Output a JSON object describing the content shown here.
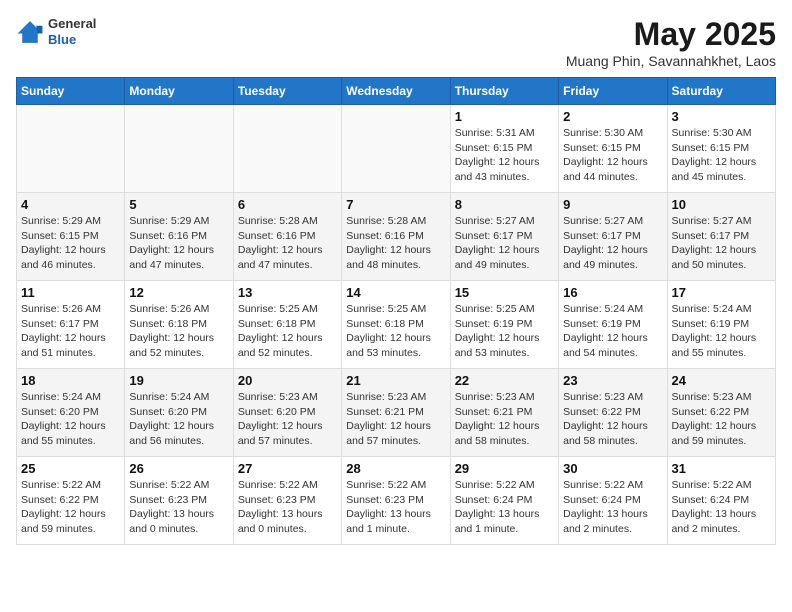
{
  "app": {
    "name_general": "General",
    "name_blue": "Blue"
  },
  "title": "May 2025",
  "subtitle": "Muang Phin, Savannahkhet, Laos",
  "days_of_week": [
    "Sunday",
    "Monday",
    "Tuesday",
    "Wednesday",
    "Thursday",
    "Friday",
    "Saturday"
  ],
  "weeks": [
    [
      {
        "day": "",
        "info": ""
      },
      {
        "day": "",
        "info": ""
      },
      {
        "day": "",
        "info": ""
      },
      {
        "day": "",
        "info": ""
      },
      {
        "day": "1",
        "info": "Sunrise: 5:31 AM\nSunset: 6:15 PM\nDaylight: 12 hours and 43 minutes."
      },
      {
        "day": "2",
        "info": "Sunrise: 5:30 AM\nSunset: 6:15 PM\nDaylight: 12 hours and 44 minutes."
      },
      {
        "day": "3",
        "info": "Sunrise: 5:30 AM\nSunset: 6:15 PM\nDaylight: 12 hours and 45 minutes."
      }
    ],
    [
      {
        "day": "4",
        "info": "Sunrise: 5:29 AM\nSunset: 6:15 PM\nDaylight: 12 hours and 46 minutes."
      },
      {
        "day": "5",
        "info": "Sunrise: 5:29 AM\nSunset: 6:16 PM\nDaylight: 12 hours and 47 minutes."
      },
      {
        "day": "6",
        "info": "Sunrise: 5:28 AM\nSunset: 6:16 PM\nDaylight: 12 hours and 47 minutes."
      },
      {
        "day": "7",
        "info": "Sunrise: 5:28 AM\nSunset: 6:16 PM\nDaylight: 12 hours and 48 minutes."
      },
      {
        "day": "8",
        "info": "Sunrise: 5:27 AM\nSunset: 6:17 PM\nDaylight: 12 hours and 49 minutes."
      },
      {
        "day": "9",
        "info": "Sunrise: 5:27 AM\nSunset: 6:17 PM\nDaylight: 12 hours and 49 minutes."
      },
      {
        "day": "10",
        "info": "Sunrise: 5:27 AM\nSunset: 6:17 PM\nDaylight: 12 hours and 50 minutes."
      }
    ],
    [
      {
        "day": "11",
        "info": "Sunrise: 5:26 AM\nSunset: 6:17 PM\nDaylight: 12 hours and 51 minutes."
      },
      {
        "day": "12",
        "info": "Sunrise: 5:26 AM\nSunset: 6:18 PM\nDaylight: 12 hours and 52 minutes."
      },
      {
        "day": "13",
        "info": "Sunrise: 5:25 AM\nSunset: 6:18 PM\nDaylight: 12 hours and 52 minutes."
      },
      {
        "day": "14",
        "info": "Sunrise: 5:25 AM\nSunset: 6:18 PM\nDaylight: 12 hours and 53 minutes."
      },
      {
        "day": "15",
        "info": "Sunrise: 5:25 AM\nSunset: 6:19 PM\nDaylight: 12 hours and 53 minutes."
      },
      {
        "day": "16",
        "info": "Sunrise: 5:24 AM\nSunset: 6:19 PM\nDaylight: 12 hours and 54 minutes."
      },
      {
        "day": "17",
        "info": "Sunrise: 5:24 AM\nSunset: 6:19 PM\nDaylight: 12 hours and 55 minutes."
      }
    ],
    [
      {
        "day": "18",
        "info": "Sunrise: 5:24 AM\nSunset: 6:20 PM\nDaylight: 12 hours and 55 minutes."
      },
      {
        "day": "19",
        "info": "Sunrise: 5:24 AM\nSunset: 6:20 PM\nDaylight: 12 hours and 56 minutes."
      },
      {
        "day": "20",
        "info": "Sunrise: 5:23 AM\nSunset: 6:20 PM\nDaylight: 12 hours and 57 minutes."
      },
      {
        "day": "21",
        "info": "Sunrise: 5:23 AM\nSunset: 6:21 PM\nDaylight: 12 hours and 57 minutes."
      },
      {
        "day": "22",
        "info": "Sunrise: 5:23 AM\nSunset: 6:21 PM\nDaylight: 12 hours and 58 minutes."
      },
      {
        "day": "23",
        "info": "Sunrise: 5:23 AM\nSunset: 6:22 PM\nDaylight: 12 hours and 58 minutes."
      },
      {
        "day": "24",
        "info": "Sunrise: 5:23 AM\nSunset: 6:22 PM\nDaylight: 12 hours and 59 minutes."
      }
    ],
    [
      {
        "day": "25",
        "info": "Sunrise: 5:22 AM\nSunset: 6:22 PM\nDaylight: 12 hours and 59 minutes."
      },
      {
        "day": "26",
        "info": "Sunrise: 5:22 AM\nSunset: 6:23 PM\nDaylight: 13 hours and 0 minutes."
      },
      {
        "day": "27",
        "info": "Sunrise: 5:22 AM\nSunset: 6:23 PM\nDaylight: 13 hours and 0 minutes."
      },
      {
        "day": "28",
        "info": "Sunrise: 5:22 AM\nSunset: 6:23 PM\nDaylight: 13 hours and 1 minute."
      },
      {
        "day": "29",
        "info": "Sunrise: 5:22 AM\nSunset: 6:24 PM\nDaylight: 13 hours and 1 minute."
      },
      {
        "day": "30",
        "info": "Sunrise: 5:22 AM\nSunset: 6:24 PM\nDaylight: 13 hours and 2 minutes."
      },
      {
        "day": "31",
        "info": "Sunrise: 5:22 AM\nSunset: 6:24 PM\nDaylight: 13 hours and 2 minutes."
      }
    ]
  ]
}
